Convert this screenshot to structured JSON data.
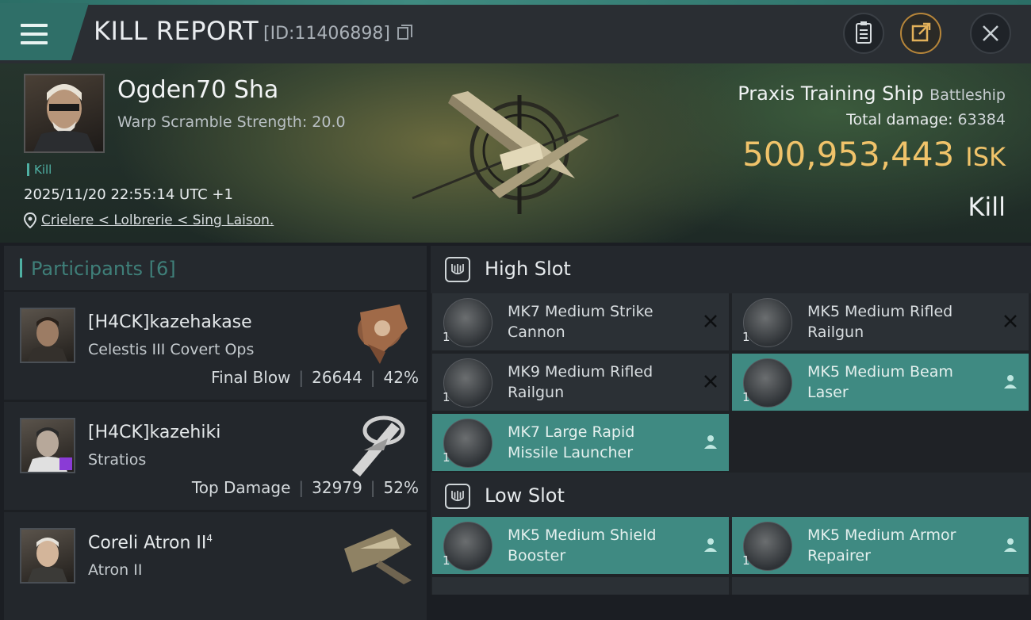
{
  "header": {
    "title": "KILL REPORT",
    "report_id": "[ID:11406898]"
  },
  "victim": {
    "name": "Ogden70 Sha",
    "warp_scramble": "Warp Scramble Strength: 20.0",
    "tag": "Kill",
    "timestamp": "2025/11/20 22:55:14 UTC +1",
    "location": "Crielere < Lolbrerie < Sing Laison."
  },
  "ship": {
    "name": "Praxis Training Ship",
    "class": "Battleship",
    "damage_label": "Total damage:",
    "damage_value": "63384",
    "isk_value": "500,953,443",
    "isk_unit": "ISK",
    "result": "Kill"
  },
  "participants": {
    "title": "Participants",
    "count": "[6]",
    "rows": [
      {
        "name": "[H4CK]kazehakase",
        "ship": "Celestis III Covert Ops",
        "role": "Final Blow",
        "damage": "26644",
        "percent": "42%"
      },
      {
        "name": "[H4CK]kazehiki",
        "ship": "Stratios",
        "role": "Top Damage",
        "damage": "32979",
        "percent": "52%"
      },
      {
        "name": "Coreli Atron II",
        "name_sup": "4",
        "ship": "Atron II"
      }
    ]
  },
  "slots": {
    "high": {
      "label": "High Slot",
      "modules": [
        {
          "name": "MK7 Medium Strike Cannon",
          "qty": "1",
          "status": "destroyed"
        },
        {
          "name": "MK5 Medium Rifled Railgun",
          "qty": "1",
          "status": "destroyed"
        },
        {
          "name": "MK9 Medium Rifled Railgun",
          "qty": "1",
          "status": "destroyed"
        },
        {
          "name": "MK5 Medium Beam Laser",
          "qty": "1",
          "status": "dropped"
        },
        {
          "name": "MK7 Large Rapid Missile Launcher",
          "qty": "1",
          "status": "dropped"
        }
      ]
    },
    "low": {
      "label": "Low Slot",
      "modules": [
        {
          "name": "MK5 Medium Shield Booster",
          "qty": "1",
          "status": "dropped"
        },
        {
          "name": "MK5 Medium Armor Repairer",
          "qty": "1",
          "status": "dropped"
        }
      ]
    }
  },
  "colors": {
    "accent": "#3f8a82",
    "isk": "#f0c36a",
    "teal_text": "#4fb0a3"
  },
  "icons": {
    "menu": "menu-icon",
    "copy": "copy-icon",
    "clipboard": "clipboard-icon",
    "share": "share-icon",
    "close": "close-icon",
    "location": "location-pin-icon",
    "slot": "slot-shield-icon",
    "destroyed": "x-icon",
    "dropped": "person-icon"
  }
}
